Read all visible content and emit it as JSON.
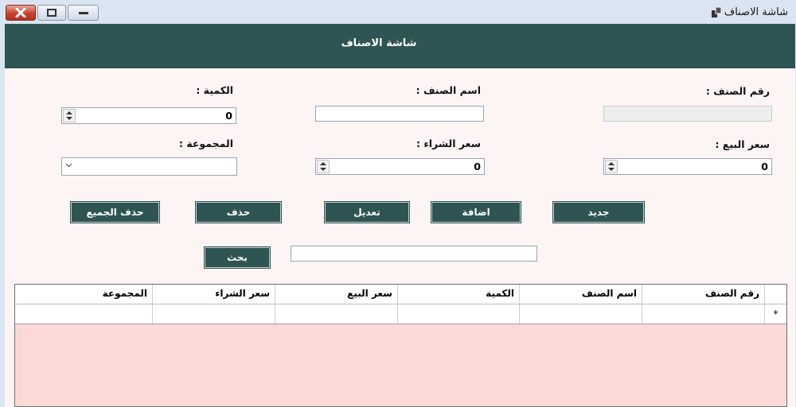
{
  "window": {
    "title": "شاشة الاصناف",
    "icon": "app-window-icon",
    "controls": [
      "close-icon",
      "maximize-icon",
      "minimize-icon"
    ]
  },
  "header": {
    "title": "شاشة الاصناف"
  },
  "colors": {
    "accent": "#2e5553",
    "panel": "#fdf4f4",
    "grid_empty": "#fbd9d6",
    "titlebar": "#dbe5f1"
  },
  "form": {
    "item_number": {
      "label": "رقم الصنف :",
      "value": ""
    },
    "item_name": {
      "label": "اسم الصنف :",
      "value": ""
    },
    "quantity": {
      "label": "الكمية :",
      "value": "0"
    },
    "sale_price": {
      "label": "سعر البيع :",
      "value": "0"
    },
    "purchase_price": {
      "label": "سعر الشراء :",
      "value": "0"
    },
    "group": {
      "label": "المجموعة :",
      "value": ""
    }
  },
  "buttons": {
    "new": "جديد",
    "add": "اضافة",
    "edit": "تعديل",
    "delete": "حذف",
    "delete_all": "حذف الجميع",
    "search": "بحث"
  },
  "search": {
    "value": ""
  },
  "grid": {
    "columns": [
      "رقم الصنف",
      "اسم الصنف",
      "الكمية",
      "سعر البيع",
      "سعر الشراء",
      "المجموعة"
    ],
    "new_row_marker": "*"
  }
}
